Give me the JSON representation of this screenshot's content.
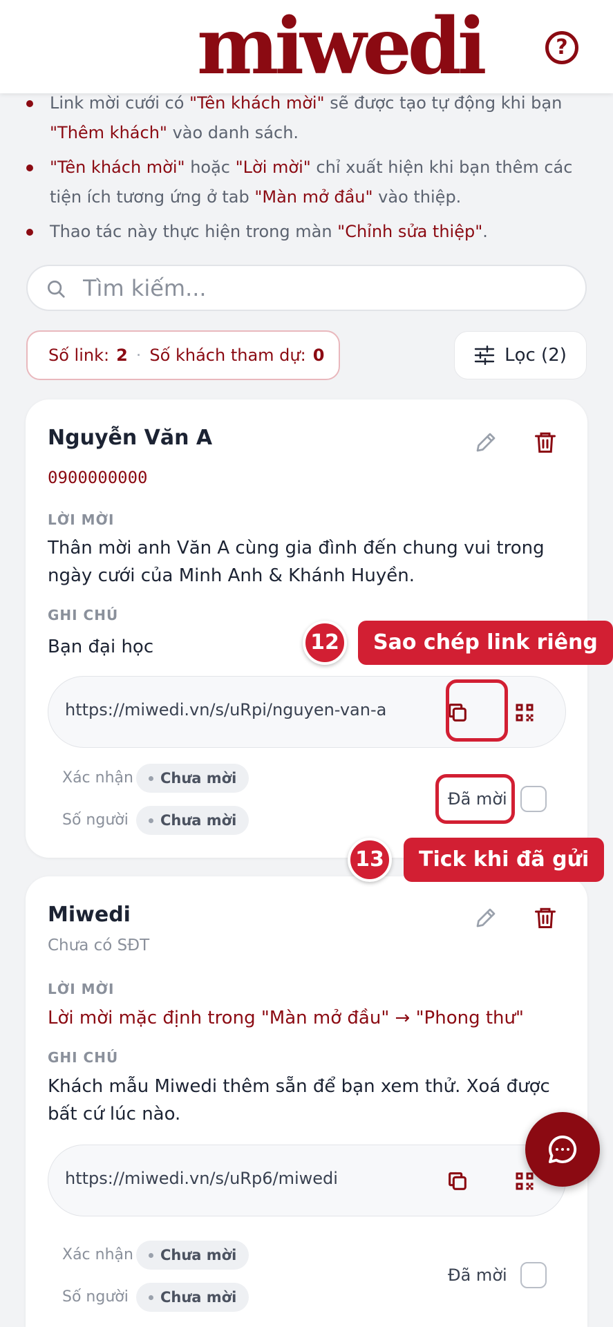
{
  "header": {
    "logo": "miwedi",
    "help": "?"
  },
  "notes": {
    "n1": {
      "a": "Link mời cưới có ",
      "b": "\"Tên khách mời\"",
      "c": " sẽ được tạo tự động khi bạn ",
      "d": "\"Thêm khách\"",
      "e": " vào danh sách."
    },
    "n2": {
      "a": "\"Tên khách mời\"",
      "b": " hoặc ",
      "c": "\"Lời mời\"",
      "d": " chỉ xuất hiện khi bạn thêm các tiện ích tương ứng ở tab ",
      "e": "\"Màn mở đầu\"",
      "f": " vào thiệp."
    },
    "n3": {
      "a": "Thao tác này thực hiện trong màn ",
      "b": "\"Chỉnh sửa thiệp\"",
      "c": "."
    }
  },
  "search": {
    "placeholder": "Tìm kiếm..."
  },
  "stats": {
    "links_label": "Số link:",
    "links_value": "2",
    "guests_label": "Số khách tham dự:",
    "guests_value": "0"
  },
  "filter": {
    "label": "Lọc (2)"
  },
  "guests": [
    {
      "name": "Nguyễn Văn A",
      "phone": "0900000000",
      "invite_label": "LỜI MỜI",
      "invite_text": "Thân mời anh Văn A cùng gia đình đến chung vui trong ngày cưới của Minh Anh & Khánh Huyền.",
      "note_label": "GHI CHÚ",
      "note_text": "Bạn đại học",
      "link": "https://miwedi.vn/s/uRpi/nguyen-van-a",
      "confirm_label": "Xác nhận",
      "confirm_value": "Chưa mời",
      "people_label": "Số người",
      "people_value": "Chưa mời",
      "invited_label": "Đã mời"
    },
    {
      "name": "Miwedi",
      "phone": "Chưa có SĐT",
      "invite_label": "LỜI MỜI",
      "invite_text": "Lời mời mặc định trong \"Màn mở đầu\" → \"Phong thư\"",
      "note_label": "GHI CHÚ",
      "note_text": "Khách mẫu Miwedi thêm sẵn để bạn xem thử. Xoá được bất cứ lúc nào.",
      "link": "https://miwedi.vn/s/uRp6/miwedi",
      "confirm_label": "Xác nhận",
      "confirm_value": "Chưa mời",
      "people_label": "Số người",
      "people_value": "Chưa mời",
      "invited_label": "Đã mời"
    }
  ],
  "annotations": [
    {
      "number": "12",
      "label": "Sao chép link riêng"
    },
    {
      "number": "13",
      "label": "Tick khi đã gửi"
    }
  ],
  "colors": {
    "brand": "#8b0a12",
    "annotation": "#d21f33"
  }
}
